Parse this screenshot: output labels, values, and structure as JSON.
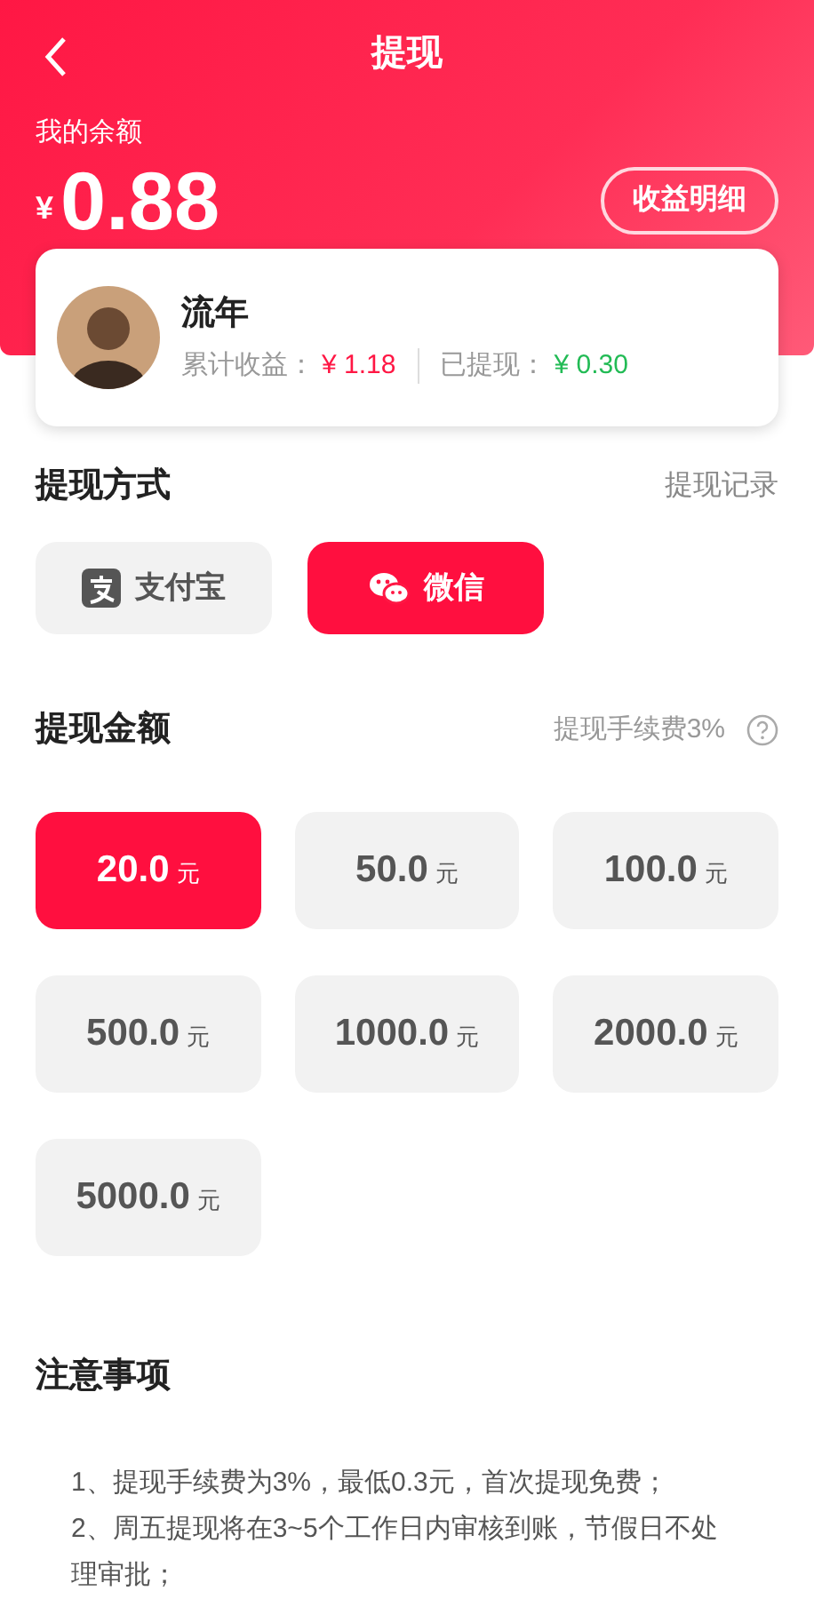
{
  "header": {
    "title": "提现",
    "balance_label": "我的余额",
    "currency": "¥",
    "balance": "0.88",
    "details_button": "收益明细"
  },
  "user": {
    "name": "流年",
    "total_label": "累计收益：",
    "total": "¥ 1.18",
    "withdrawn_label": "已提现：",
    "withdrawn": "¥ 0.30"
  },
  "method_section": {
    "title": "提现方式",
    "link": "提现记录"
  },
  "methods": [
    {
      "kind": "alipay",
      "label": "支付宝",
      "selected": false
    },
    {
      "kind": "wechat",
      "label": "微信",
      "selected": true
    }
  ],
  "amount_section": {
    "title": "提现金额",
    "fee_note": "提现手续费3%"
  },
  "amounts": [
    {
      "value": "20.0",
      "unit": "元",
      "selected": true
    },
    {
      "value": "50.0",
      "unit": "元",
      "selected": false
    },
    {
      "value": "100.0",
      "unit": "元",
      "selected": false
    },
    {
      "value": "500.0",
      "unit": "元",
      "selected": false
    },
    {
      "value": "1000.0",
      "unit": "元",
      "selected": false
    },
    {
      "value": "2000.0",
      "unit": "元",
      "selected": false
    },
    {
      "value": "5000.0",
      "unit": "元",
      "selected": false
    }
  ],
  "notes": {
    "title": "注意事项",
    "items": [
      "1、提现手续费为3%，最低0.3元，首次提现免费；",
      "2、周五提现将在3~5个工作日内审核到账，节假日不处理审批；"
    ]
  }
}
